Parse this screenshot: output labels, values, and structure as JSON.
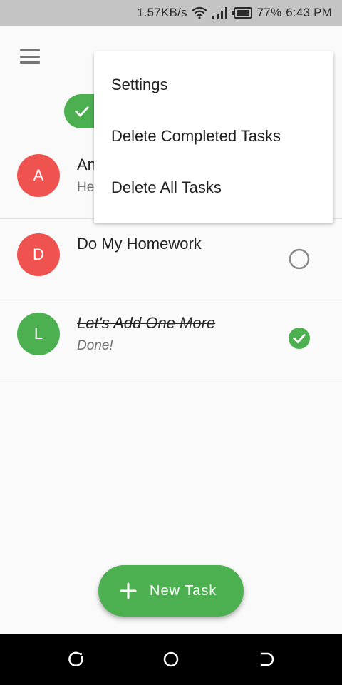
{
  "status_bar": {
    "network_speed": "1.57KB/s",
    "battery": "77%",
    "time": "6:43 PM",
    "icons": [
      "wifi-icon",
      "signal-icon",
      "battery-icon"
    ]
  },
  "toolbar": {
    "menu_icon": "hamburger-icon",
    "chip_icon": "check-icon"
  },
  "overflow_menu": {
    "items": [
      {
        "label": "Settings"
      },
      {
        "label": "Delete Completed Tasks"
      },
      {
        "label": "Delete All Tasks"
      }
    ]
  },
  "tasks": [
    {
      "initial": "A",
      "title": "An",
      "subtitle": "He",
      "completed": false,
      "avatar_color": "#ef5350"
    },
    {
      "initial": "D",
      "title": "Do My Homework",
      "subtitle": "",
      "completed": false,
      "avatar_color": "#ef5350"
    },
    {
      "initial": "L",
      "title": "Let's Add One More",
      "subtitle": "Done!",
      "completed": true,
      "avatar_color": "#4caf50"
    }
  ],
  "fab": {
    "label": "New Task",
    "icon": "plus-icon"
  },
  "nav_bar": {
    "icons": [
      "recents-icon",
      "home-icon",
      "back-icon"
    ]
  },
  "colors": {
    "accent": "#4caf50",
    "avatar_red": "#ef5350",
    "status_bar_bg": "#c4c4c4",
    "nav_bar_bg": "#000000"
  }
}
